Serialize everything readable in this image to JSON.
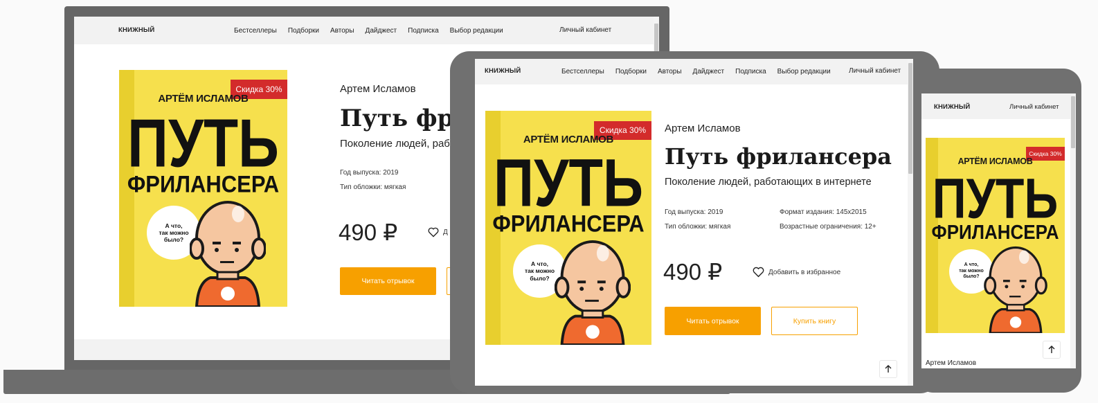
{
  "site": {
    "logo": "КНИЖНЫЙ",
    "nav": [
      "Бестселлеры",
      "Подборки",
      "Авторы",
      "Дайджест",
      "Подписка",
      "Выбор редакции"
    ],
    "account": "Личный кабинет"
  },
  "book": {
    "author": "Артем Исламов",
    "title": "Путь фрилансера",
    "title_cut": "Путь фри",
    "subtitle": "Поколение людей, работающих в интернете",
    "subtitle_cut": "Поколение людей, работ",
    "year": "Год выпуска: 2019",
    "cover_type": "Тип обложки: мягкая",
    "format": "Формат издания: 145х2015",
    "age": "Возрастные ограничения: 12+",
    "price": "490 ₽",
    "favorite": "Добавить в избранное",
    "favorite_cut": "Д",
    "read_btn": "Читать отрывок",
    "buy_btn": "Купить книгу"
  },
  "cover": {
    "author": "АРТЁМ ИСЛАМОВ",
    "title_line1": "ПУТЬ",
    "title_line2": "ФРИЛАНСЕРА",
    "badge": "Скидка 30%",
    "bubble_l1": "А что,",
    "bubble_l2": "так можно",
    "bubble_l3": "было?"
  },
  "icons": {
    "heart": "heart-icon",
    "arrow_up": "arrow-up-icon"
  },
  "colors": {
    "accent": "#f7a000",
    "badge": "#d32b2b",
    "cover": "#f6e04d"
  }
}
